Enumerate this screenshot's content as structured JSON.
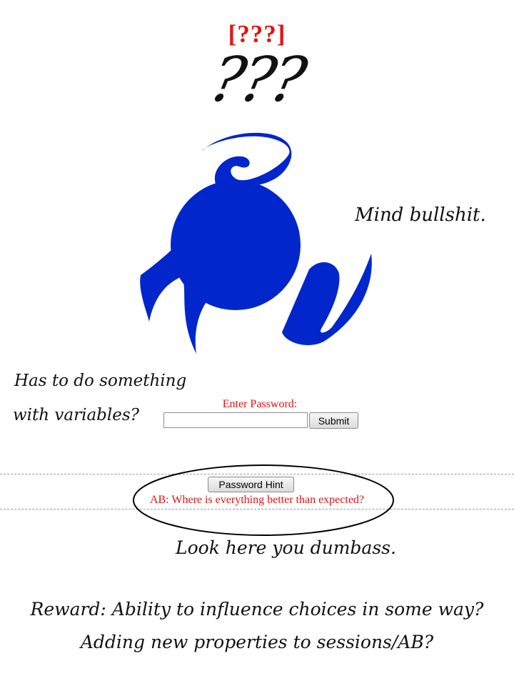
{
  "page": {
    "title": "[???]",
    "annotation_qmarks": "???",
    "annotation_mind": "Mind bullshit.",
    "annotation_variables_line1": "Has to do something",
    "annotation_variables_line2": "with variables?",
    "annotation_look": "Look here you dumbass.",
    "annotation_reward_line1": "Reward: Ability to influence choices in some way?",
    "annotation_reward_line2": "Adding new properties to sessions/AB?"
  },
  "password_form": {
    "label": "Enter Password:",
    "value": "",
    "submit_label": "Submit"
  },
  "hint": {
    "button_label": "Password Hint",
    "text": "AB: Where is everything better than expected?"
  },
  "colors": {
    "accent_red": "#e31414",
    "logo_blue": "#0026cc"
  }
}
